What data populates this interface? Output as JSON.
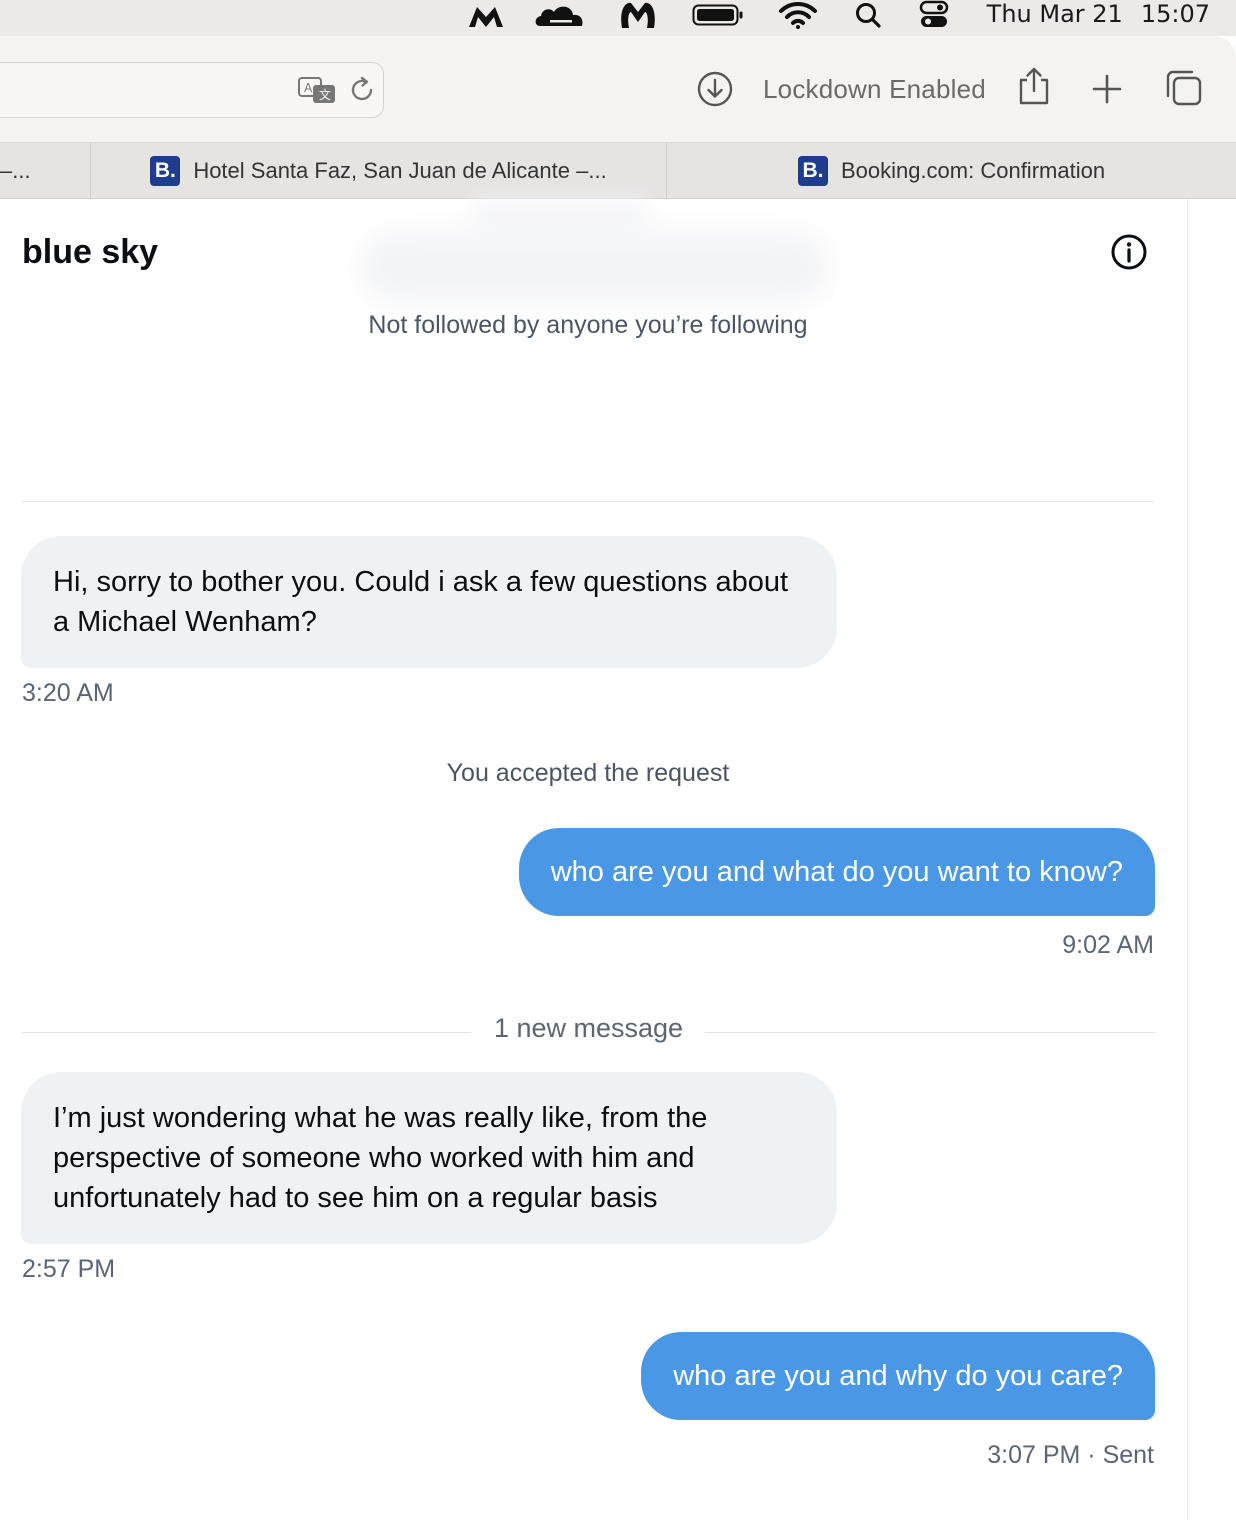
{
  "menubar": {
    "day": "Thu Mar 21",
    "time": "15:07"
  },
  "toolbar": {
    "lockdown_label": "Lockdown Enabled"
  },
  "tabs": [
    {
      "label": "–..."
    },
    {
      "favicon": "B.",
      "label": "Hotel Santa Faz, San Juan de Alicante –..."
    },
    {
      "favicon": "B.",
      "label": "Booking.com: Confirmation"
    }
  ],
  "conversation": {
    "title": "blue sky",
    "followed_note": "Not followed by anyone you’re following",
    "messages": [
      {
        "direction": "in",
        "text": "Hi, sorry to bother you. Could i ask a few questions about a Michael Wenham?",
        "time": "3:20 AM"
      },
      {
        "type": "system",
        "text": "You accepted the request"
      },
      {
        "direction": "out",
        "text": "who are you and what do you want to know?",
        "time": "9:02 AM"
      },
      {
        "type": "divider",
        "text": "1 new message"
      },
      {
        "direction": "in",
        "text": "I’m just wondering what he was really like, from the perspective of someone who worked with him and unfortunately had to see him on a regular basis",
        "time": "2:57 PM"
      },
      {
        "direction": "out",
        "text": "who are you and why do you care?",
        "time": "3:07 PM · Sent"
      }
    ]
  },
  "colors": {
    "outgoing_bubble": "#4a97e6",
    "incoming_bubble": "#eff2f4",
    "favicon_bg": "#1e3d8f"
  },
  "icons": [
    "wing-icon",
    "cloudflare-icon",
    "malwarebytes-icon",
    "battery-icon",
    "wifi-icon",
    "spotlight-search-icon",
    "control-center-icon",
    "translate-icon",
    "reload-icon",
    "download-icon",
    "share-icon",
    "new-tab-plus-icon",
    "tab-overview-icon",
    "info-icon"
  ]
}
